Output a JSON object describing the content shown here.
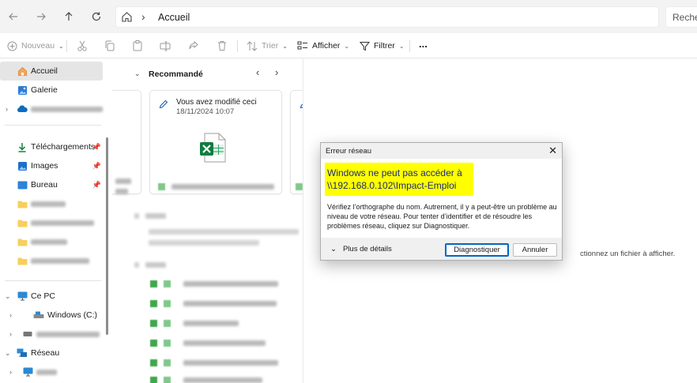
{
  "address_bar": {
    "back_icon": "arrow-left-icon",
    "forward_icon": "arrow-right-icon",
    "up_icon": "arrow-up-icon",
    "refresh_icon": "refresh-icon",
    "location": "Accueil",
    "search_placeholder": "Recher"
  },
  "command_bar": {
    "new_label": "Nouveau",
    "sort_label": "Trier",
    "view_label": "Afficher",
    "filter_label": "Filtrer",
    "more_label": "..."
  },
  "sidebar": {
    "home": "Accueil",
    "gallery": "Galerie",
    "downloads": "Téléchargements",
    "images": "Images",
    "desktop": "Bureau",
    "this_pc": "Ce PC",
    "drive_c": "Windows  (C:)",
    "network": "Réseau"
  },
  "main": {
    "recommended_title": "Recommandé",
    "card_activity": "Vous avez modifié ceci",
    "card_date": "18/11/2024 10:07"
  },
  "preview": {
    "hint": "ctionnez un fichier à afficher."
  },
  "dialog": {
    "title": "Erreur réseau",
    "headline_line1": "Windows ne peut pas accéder à",
    "headline_line2": "\\\\192.168.0.102\\Impact-Emploi",
    "message": "Vérifiez l’orthographe du nom. Autrement, il y a peut-être un problème au niveau de votre réseau. Pour tenter d’identifier et de résoudre les problèmes réseau, cliquez sur Diagnostiquer.",
    "details_label": "Plus de détails",
    "diagnose_button": "Diagnostiquer",
    "cancel_button": "Annuler"
  },
  "colors": {
    "highlight": "#ffff00",
    "headline_text": "#1a2a7a",
    "excel_green": "#107c41",
    "accent": "#0067c0"
  }
}
